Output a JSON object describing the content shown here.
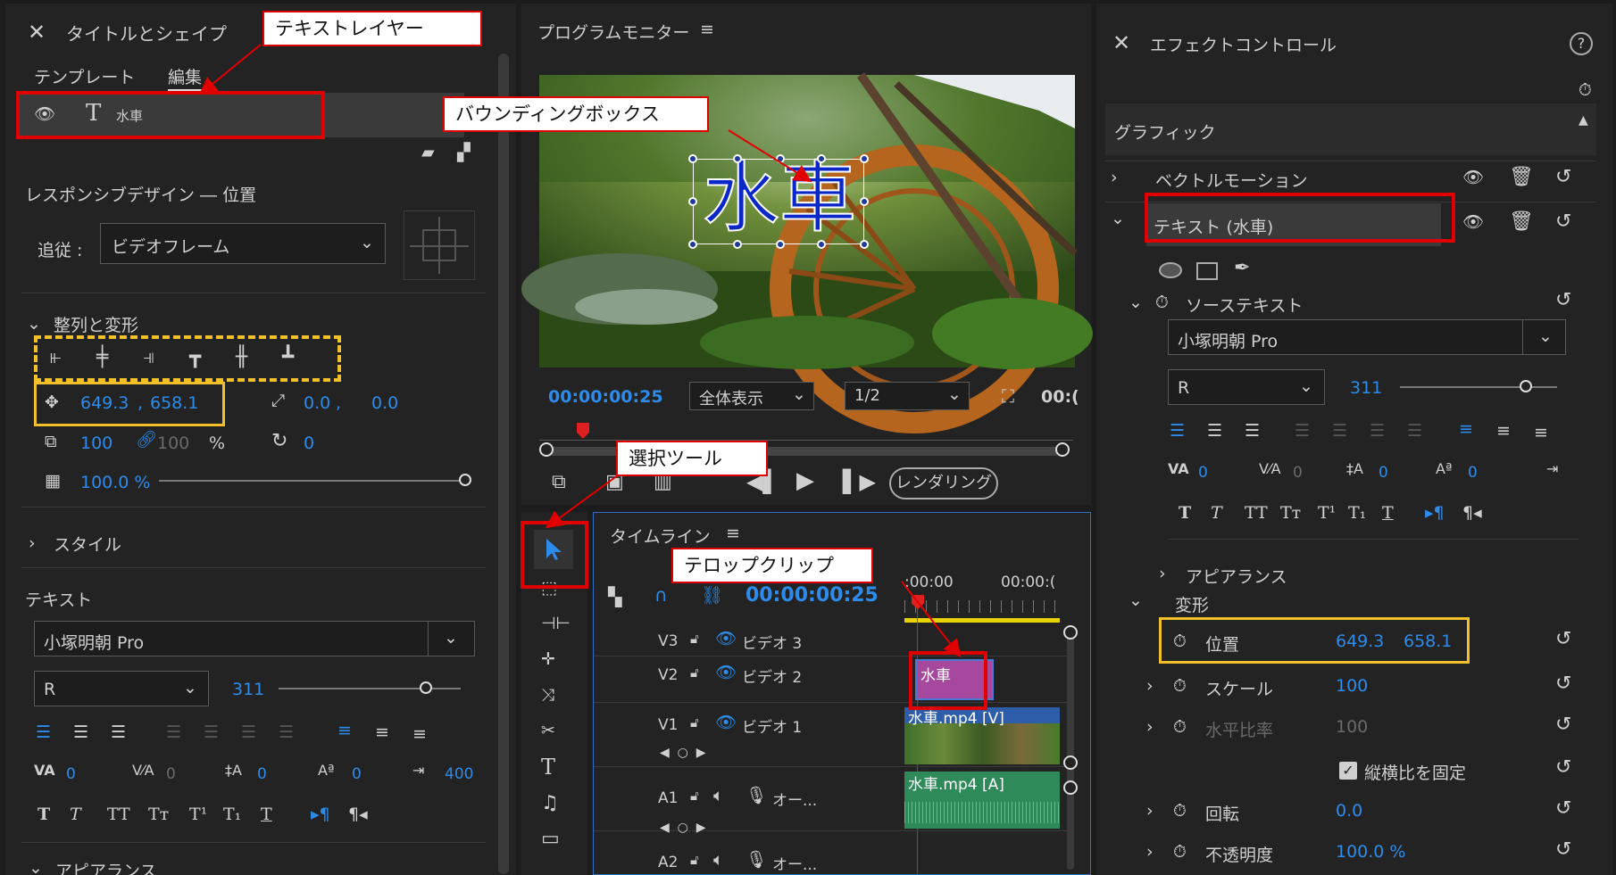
{
  "callouts": {
    "text_layer": "テキストレイヤー",
    "bbox": "バウンディングボックス",
    "select_tool": "選択ツール",
    "telop_clip": "テロップクリップ"
  },
  "left": {
    "title": "タイトルとシェイプ",
    "tab_template": "テンプレート",
    "tab_edit": "編集",
    "layer_name": "水車",
    "responsive_heading": "レスポンシブデザイン ― 位置",
    "follow_label": "追従 :",
    "follow_value": "ビデオフレーム",
    "align_heading": "整列と変形",
    "pos_x": "649.3",
    "pos_sep": ",",
    "pos_y": "658.1",
    "anchor_x": "0.0",
    "anchor_sep": ",",
    "anchor_y": "0.0",
    "scale": "100",
    "scale2": "100",
    "pct": "%",
    "rotation": "0",
    "opacity": "100.0 %",
    "style_heading": "スタイル",
    "text_heading": "テキスト",
    "font": "小塚明朝 Pro",
    "weight": "R",
    "size": "311",
    "kern": "0",
    "track": "0",
    "lead": "0",
    "baseline": "0",
    "tab": "400",
    "appearance": "アピアランス"
  },
  "monitor": {
    "title": "プログラムモニター",
    "overlay_text": "水車",
    "timecode": "00:00:00:25",
    "zoom": "全体表示",
    "res": "1/2",
    "tc_right": "00:(",
    "render": "レンダリング"
  },
  "timeline": {
    "title": "タイムライン",
    "timecode": "00:00:00:25",
    "ruler_start": ":00:00",
    "ruler_end": "00:00:(",
    "tracks": [
      {
        "id": "V3",
        "name": "ビデオ 3"
      },
      {
        "id": "V2",
        "name": "ビデオ 2"
      },
      {
        "id": "V1",
        "name": "ビデオ 1"
      },
      {
        "id": "A1",
        "name": "オー..."
      },
      {
        "id": "A2",
        "name": "オー..."
      }
    ],
    "clip_title": "水車",
    "clip_v1": "水車.mp4 [V]",
    "clip_a1": "水車.mp4 [A]"
  },
  "effects": {
    "title": "エフェクトコントロール",
    "help": "?",
    "graphic": "グラフィック",
    "vector": "ベクトルモーション",
    "text_layer": "テキスト (水車)",
    "source_text": "ソーステキスト",
    "font": "小塚明朝 Pro",
    "weight": "R",
    "size": "311",
    "kern": "0",
    "track": "0",
    "lead": "0",
    "baseline": "0",
    "appearance": "アピアランス",
    "transform": "変形",
    "pos_label": "位置",
    "pos_x": "649.3",
    "pos_y": "658.1",
    "scale_label": "スケール",
    "scale": "100",
    "hscale_label": "水平比率",
    "hscale": "100",
    "lock_label": "縦横比を固定",
    "rot_label": "回転",
    "rot": "0.0",
    "opa_label": "不透明度",
    "opa": "100.0 %"
  }
}
